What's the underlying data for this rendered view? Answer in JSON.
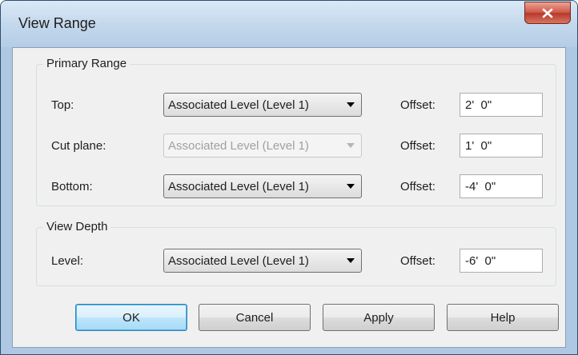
{
  "window": {
    "title": "View Range"
  },
  "primary_range": {
    "label": "Primary Range",
    "rows": [
      {
        "label": "Top:",
        "level": "Associated Level (Level 1)",
        "offset_label": "Offset:",
        "offset": "2'  0\""
      },
      {
        "label": "Cut plane:",
        "level": "Associated Level (Level 1)",
        "offset_label": "Offset:",
        "offset": "1'  0\""
      },
      {
        "label": "Bottom:",
        "level": "Associated Level (Level 1)",
        "offset_label": "Offset:",
        "offset": "-4'  0\""
      }
    ]
  },
  "view_depth": {
    "label": "View Depth",
    "row": {
      "label": "Level:",
      "level": "Associated Level (Level 1)",
      "offset_label": "Offset:",
      "offset": "-6'  0\""
    }
  },
  "buttons": {
    "ok": "OK",
    "cancel": "Cancel",
    "apply": "Apply",
    "help": "Help"
  },
  "icons": {
    "close": "close-icon",
    "dropdown": "chevron-down-icon"
  },
  "colors": {
    "close_button": "#c9473a",
    "default_button_border": "#3c7fb1",
    "client_bg": "#f0f0f0"
  }
}
